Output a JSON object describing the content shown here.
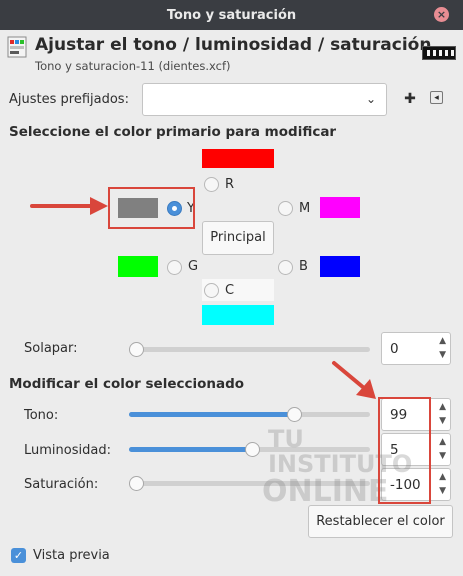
{
  "window": {
    "title": "Tono y saturación",
    "close_glyph": "×"
  },
  "header": {
    "title": "Ajustar el tono / luminosidad / saturación",
    "subtitle": "Tono y saturacion-11 (dientes.xcf)",
    "icon": "hue-saturation-icon"
  },
  "presets": {
    "label": "Ajustes prefijados:",
    "value": "",
    "chevron": "⌄",
    "add_glyph": "✚",
    "menu_glyph": "◂"
  },
  "primary": {
    "heading": "Seleccione el color primario para modificar",
    "colors": {
      "R": "#ff0000",
      "Y": "#808080",
      "M": "#ff00ff",
      "G": "#00ff00",
      "B": "#0000ff",
      "C": "#00ffff"
    },
    "labels": {
      "R": "R",
      "Y": "Y",
      "M": "M",
      "G": "G",
      "B": "B",
      "C": "C"
    },
    "selected": "Y",
    "master_button": "Principal"
  },
  "overlap": {
    "label": "Solapar:",
    "value": "0",
    "fraction": 0.0
  },
  "modify": {
    "heading": "Modificar el color seleccionado",
    "hue": {
      "label": "Tono:",
      "value": "99",
      "fraction": 0.685
    },
    "lightness": {
      "label": "Luminosidad:",
      "value": "5",
      "fraction": 0.51
    },
    "saturation": {
      "label": "Saturación:",
      "value": "-100",
      "fraction": 0.0
    },
    "reset_button": "Restablecer el color"
  },
  "preview": {
    "label": "Vista previa",
    "checked": true
  },
  "watermark": {
    "line1": "TU",
    "line2": "INSTITUTO",
    "line3": "ONLINE"
  },
  "accent": "#4a90d9",
  "annotation_color": "#d9463b"
}
